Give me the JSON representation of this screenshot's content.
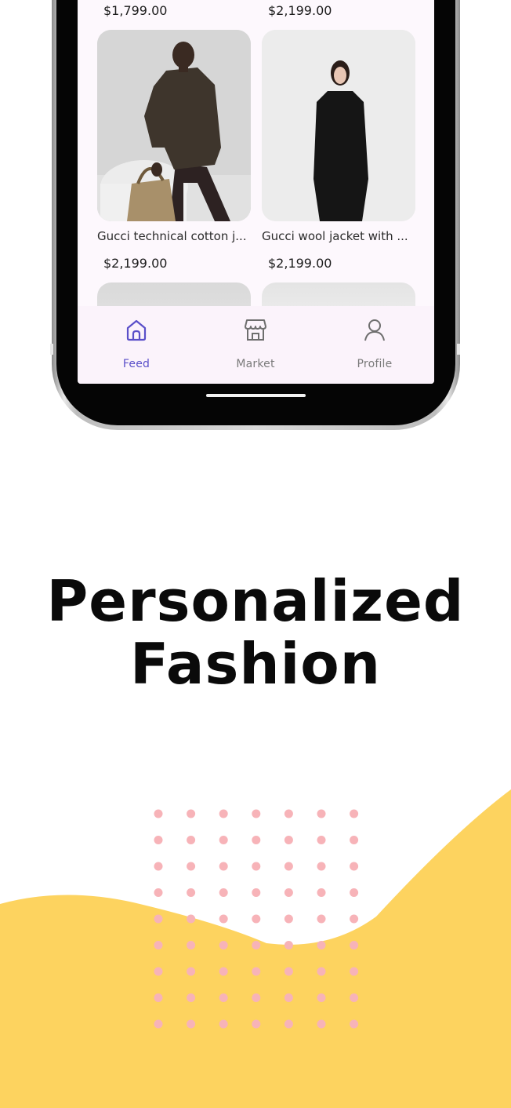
{
  "feed": {
    "row_top_prices": [
      "$1,799.00",
      "$2,199.00"
    ],
    "products": [
      {
        "title": "Gucci technical cotton j...",
        "price": "$2,199.00"
      },
      {
        "title": "Gucci wool jacket with ...",
        "price": "$2,199.00"
      }
    ]
  },
  "bottom_nav": {
    "items": [
      {
        "label": "Feed",
        "icon": "home-icon",
        "active": true
      },
      {
        "label": "Market",
        "icon": "store-icon",
        "active": false
      },
      {
        "label": "Profile",
        "icon": "user-icon",
        "active": false
      }
    ]
  },
  "headline": {
    "line1": "Personalized",
    "line2": "Fashion"
  },
  "colors": {
    "accent": "#5a4fc9",
    "wave": "#fdd35f",
    "dots": "#f7b3b8",
    "screen_bg": "#fdf8fd"
  }
}
